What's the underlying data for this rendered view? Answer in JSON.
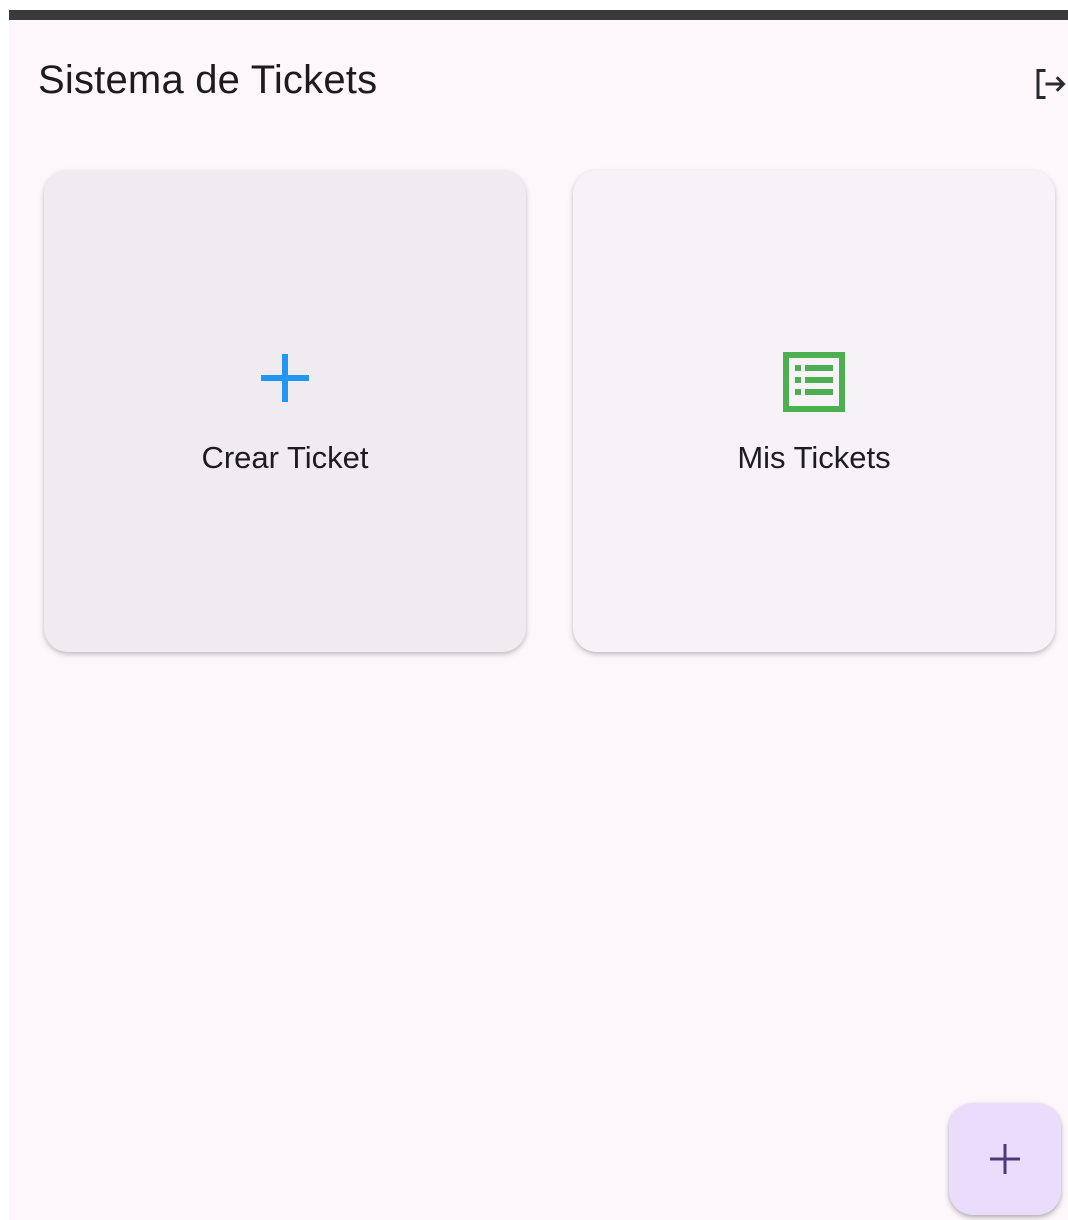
{
  "app_bar": {
    "title": "Sistema de Tickets",
    "logout_icon": "logout-icon"
  },
  "cards": [
    {
      "label": "Crear Ticket",
      "icon": "add-icon",
      "icon_color": "#2196f3"
    },
    {
      "label": "Mis Tickets",
      "icon": "list-icon",
      "icon_color": "#4caf50"
    }
  ],
  "fab": {
    "icon": "add-icon",
    "icon_color": "#4a3a7a",
    "background": "#eaddfc"
  },
  "colors": {
    "background": "#fdf7fc",
    "status_bar": "#3a393b",
    "text": "#1d1b20"
  }
}
